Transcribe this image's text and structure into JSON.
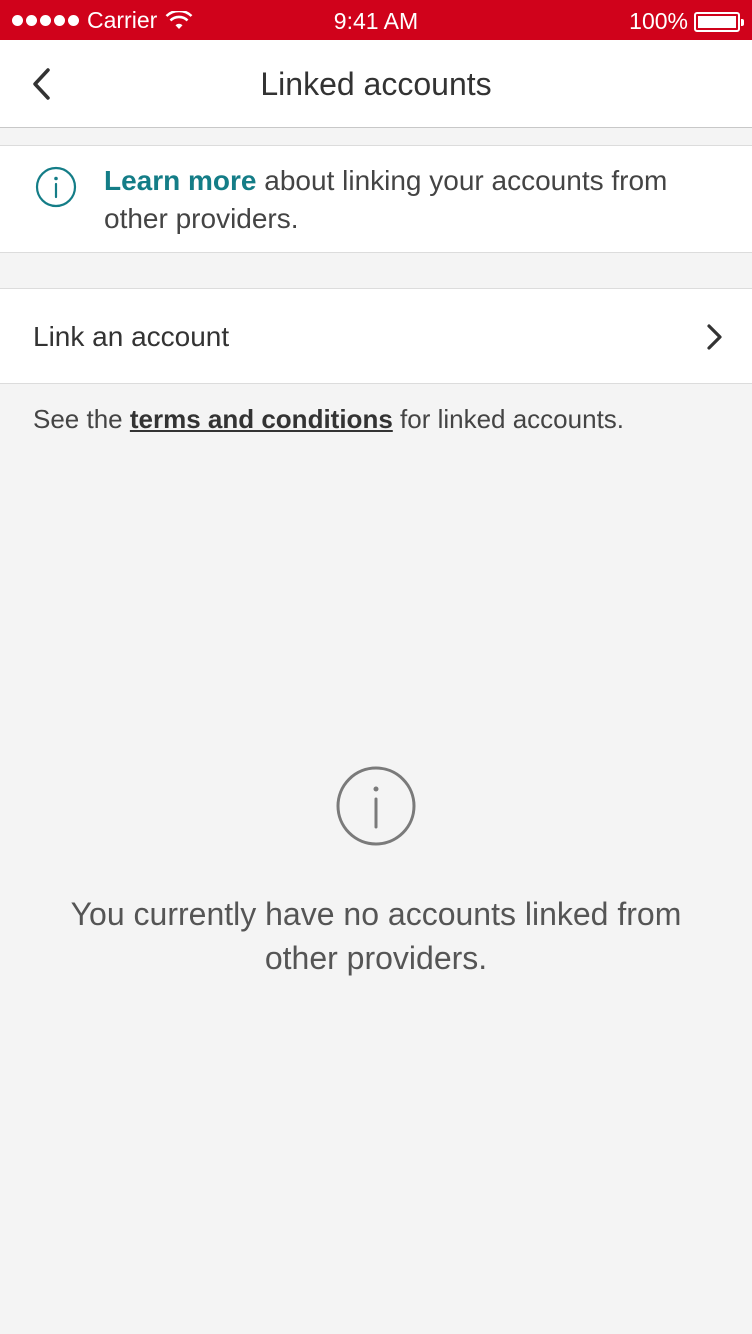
{
  "status_bar": {
    "carrier": "Carrier",
    "time": "9:41 AM",
    "battery": "100%"
  },
  "nav": {
    "title": "Linked accounts",
    "back_icon": "chevron-left-icon"
  },
  "info_banner": {
    "link_text": "Learn more",
    "body_text": " about linking your accounts from other providers.",
    "icon": "info-icon",
    "accent_color": "#147d87"
  },
  "link_row": {
    "label": "Link an account",
    "icon": "chevron-right-icon"
  },
  "terms": {
    "prefix": "See the ",
    "link_text": "terms and conditions",
    "suffix": " for linked accounts."
  },
  "empty_state": {
    "icon": "info-icon",
    "message": "You currently have no accounts linked from other providers."
  },
  "colors": {
    "status_bar": "#d0021b",
    "background": "#f4f4f4"
  }
}
